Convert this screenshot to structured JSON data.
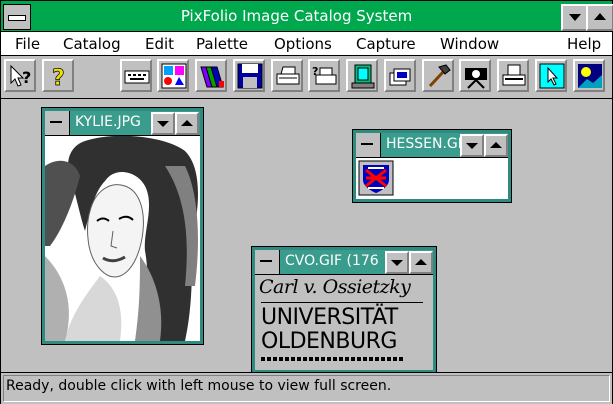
{
  "app": {
    "title": "PixFolio Image Catalog System"
  },
  "menu": {
    "items": [
      "File",
      "Catalog",
      "Edit",
      "Palette",
      "Options",
      "Capture",
      "Window",
      "Help"
    ]
  },
  "toolbar": {
    "icons": [
      "help-cursor-icon",
      "help-question-icon",
      "keyboard-icon",
      "palette-icon",
      "books-icon",
      "floppy-disk-icon",
      "printer-icon",
      "printer-query-icon",
      "slideshow-icon",
      "catalog-cards-icon",
      "hammer-icon",
      "camera-icon",
      "scanner-icon",
      "pointer-arrow-icon",
      "night-sky-icon"
    ]
  },
  "windows": {
    "kylie": {
      "title": "KYLIE.JPG"
    },
    "hessen": {
      "title": "HESSEN.GIF"
    },
    "cvo": {
      "title": "CVO.GIF (176",
      "signature": "Carl v. Ossietzky",
      "line1": "UNIVERSITÄT",
      "line2": "OLDENBURG"
    }
  },
  "status": {
    "text": "Ready, double click with left mouse to view full screen."
  },
  "colors": {
    "title_bar": "#00a84d",
    "child_title": "#3a9c8c",
    "desktop": "#c0c0c0"
  }
}
